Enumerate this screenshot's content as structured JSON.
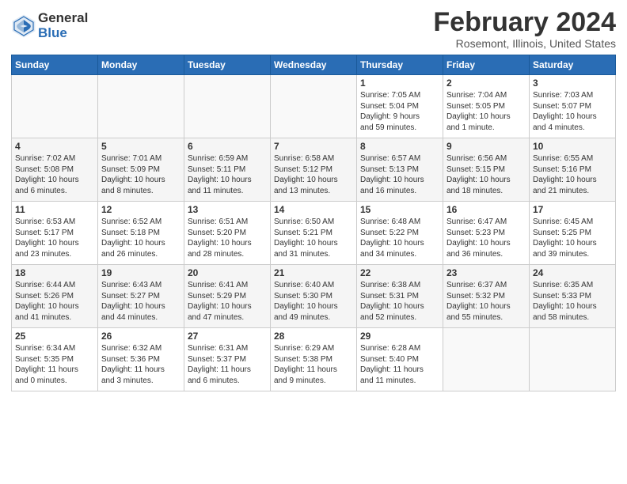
{
  "logo": {
    "general": "General",
    "blue": "Blue"
  },
  "title": "February 2024",
  "location": "Rosemont, Illinois, United States",
  "days_of_week": [
    "Sunday",
    "Monday",
    "Tuesday",
    "Wednesday",
    "Thursday",
    "Friday",
    "Saturday"
  ],
  "weeks": [
    [
      {
        "day": "",
        "info": ""
      },
      {
        "day": "",
        "info": ""
      },
      {
        "day": "",
        "info": ""
      },
      {
        "day": "",
        "info": ""
      },
      {
        "day": "1",
        "info": "Sunrise: 7:05 AM\nSunset: 5:04 PM\nDaylight: 9 hours\nand 59 minutes."
      },
      {
        "day": "2",
        "info": "Sunrise: 7:04 AM\nSunset: 5:05 PM\nDaylight: 10 hours\nand 1 minute."
      },
      {
        "day": "3",
        "info": "Sunrise: 7:03 AM\nSunset: 5:07 PM\nDaylight: 10 hours\nand 4 minutes."
      }
    ],
    [
      {
        "day": "4",
        "info": "Sunrise: 7:02 AM\nSunset: 5:08 PM\nDaylight: 10 hours\nand 6 minutes."
      },
      {
        "day": "5",
        "info": "Sunrise: 7:01 AM\nSunset: 5:09 PM\nDaylight: 10 hours\nand 8 minutes."
      },
      {
        "day": "6",
        "info": "Sunrise: 6:59 AM\nSunset: 5:11 PM\nDaylight: 10 hours\nand 11 minutes."
      },
      {
        "day": "7",
        "info": "Sunrise: 6:58 AM\nSunset: 5:12 PM\nDaylight: 10 hours\nand 13 minutes."
      },
      {
        "day": "8",
        "info": "Sunrise: 6:57 AM\nSunset: 5:13 PM\nDaylight: 10 hours\nand 16 minutes."
      },
      {
        "day": "9",
        "info": "Sunrise: 6:56 AM\nSunset: 5:15 PM\nDaylight: 10 hours\nand 18 minutes."
      },
      {
        "day": "10",
        "info": "Sunrise: 6:55 AM\nSunset: 5:16 PM\nDaylight: 10 hours\nand 21 minutes."
      }
    ],
    [
      {
        "day": "11",
        "info": "Sunrise: 6:53 AM\nSunset: 5:17 PM\nDaylight: 10 hours\nand 23 minutes."
      },
      {
        "day": "12",
        "info": "Sunrise: 6:52 AM\nSunset: 5:18 PM\nDaylight: 10 hours\nand 26 minutes."
      },
      {
        "day": "13",
        "info": "Sunrise: 6:51 AM\nSunset: 5:20 PM\nDaylight: 10 hours\nand 28 minutes."
      },
      {
        "day": "14",
        "info": "Sunrise: 6:50 AM\nSunset: 5:21 PM\nDaylight: 10 hours\nand 31 minutes."
      },
      {
        "day": "15",
        "info": "Sunrise: 6:48 AM\nSunset: 5:22 PM\nDaylight: 10 hours\nand 34 minutes."
      },
      {
        "day": "16",
        "info": "Sunrise: 6:47 AM\nSunset: 5:23 PM\nDaylight: 10 hours\nand 36 minutes."
      },
      {
        "day": "17",
        "info": "Sunrise: 6:45 AM\nSunset: 5:25 PM\nDaylight: 10 hours\nand 39 minutes."
      }
    ],
    [
      {
        "day": "18",
        "info": "Sunrise: 6:44 AM\nSunset: 5:26 PM\nDaylight: 10 hours\nand 41 minutes."
      },
      {
        "day": "19",
        "info": "Sunrise: 6:43 AM\nSunset: 5:27 PM\nDaylight: 10 hours\nand 44 minutes."
      },
      {
        "day": "20",
        "info": "Sunrise: 6:41 AM\nSunset: 5:29 PM\nDaylight: 10 hours\nand 47 minutes."
      },
      {
        "day": "21",
        "info": "Sunrise: 6:40 AM\nSunset: 5:30 PM\nDaylight: 10 hours\nand 49 minutes."
      },
      {
        "day": "22",
        "info": "Sunrise: 6:38 AM\nSunset: 5:31 PM\nDaylight: 10 hours\nand 52 minutes."
      },
      {
        "day": "23",
        "info": "Sunrise: 6:37 AM\nSunset: 5:32 PM\nDaylight: 10 hours\nand 55 minutes."
      },
      {
        "day": "24",
        "info": "Sunrise: 6:35 AM\nSunset: 5:33 PM\nDaylight: 10 hours\nand 58 minutes."
      }
    ],
    [
      {
        "day": "25",
        "info": "Sunrise: 6:34 AM\nSunset: 5:35 PM\nDaylight: 11 hours\nand 0 minutes."
      },
      {
        "day": "26",
        "info": "Sunrise: 6:32 AM\nSunset: 5:36 PM\nDaylight: 11 hours\nand 3 minutes."
      },
      {
        "day": "27",
        "info": "Sunrise: 6:31 AM\nSunset: 5:37 PM\nDaylight: 11 hours\nand 6 minutes."
      },
      {
        "day": "28",
        "info": "Sunrise: 6:29 AM\nSunset: 5:38 PM\nDaylight: 11 hours\nand 9 minutes."
      },
      {
        "day": "29",
        "info": "Sunrise: 6:28 AM\nSunset: 5:40 PM\nDaylight: 11 hours\nand 11 minutes."
      },
      {
        "day": "",
        "info": ""
      },
      {
        "day": "",
        "info": ""
      }
    ]
  ]
}
